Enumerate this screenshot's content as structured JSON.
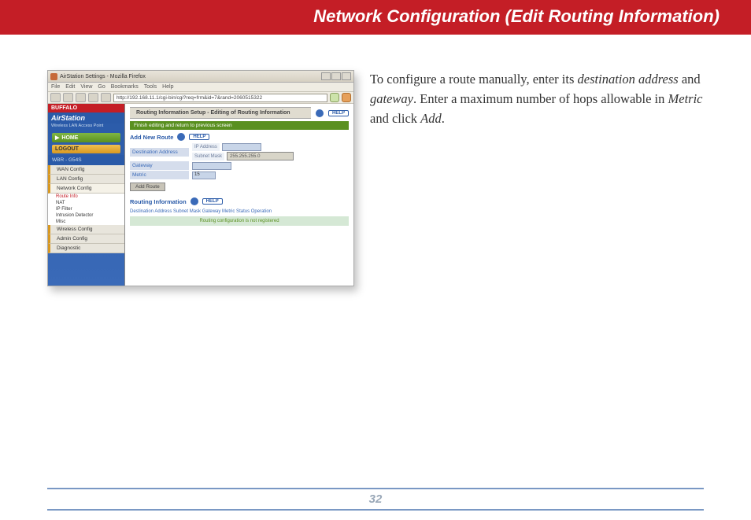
{
  "header": {
    "title": "Network Configuration (Edit Routing Information)"
  },
  "description": {
    "p1_a": "To configure a route manually, enter its ",
    "p1_em1": "destination address",
    "p1_b": " and ",
    "p1_em2": "gateway",
    "p1_c": ".  Enter a maximum number of hops allowable in ",
    "p1_em3": "Metric",
    "p1_d": " and click ",
    "p1_em4": "Add",
    "p1_e": "."
  },
  "footer": {
    "page_number": "32"
  },
  "browser": {
    "window_title": "AirStation Settings - Mozilla Firefox",
    "menu": [
      "File",
      "Edit",
      "View",
      "Go",
      "Bookmarks",
      "Tools",
      "Help"
    ],
    "url": "http://192.168.11.1/cgi-bin/cgi?req=frm&id=7&rand=2060515322",
    "sidebar": {
      "brand": "BUFFALO",
      "product": "AirStation",
      "product_sub": "Wireless LAN Access Point",
      "home": "HOME",
      "logout": "LOGOUT",
      "model": "WBR - G54S",
      "nav": [
        "WAN Config",
        "LAN Config",
        "Network Config"
      ],
      "sub": [
        "Route Info",
        "NAT",
        "IP Filter",
        "Intrusion Detector",
        "Misc"
      ],
      "nav2": [
        "Wireless Config",
        "Admin Config",
        "Diagnostic"
      ]
    },
    "main": {
      "page_title": "Routing Information Setup - Editing of Routing Information",
      "help": "HELP",
      "finish": "Finish editing and return to previous screen",
      "section_addnew": "Add New Route",
      "labels": {
        "dest": "Destination Address",
        "ip": "IP Address",
        "subnet": "Subnet Mask",
        "subnet_val": "255.255.255.0",
        "gateway": "Gateway",
        "metric": "Metric",
        "metric_val": "15",
        "add_route": "Add Route"
      },
      "section_routing": "Routing Information",
      "table_head": "Destination Address Subnet Mask Gateway Metric Status Operation",
      "table_empty": "Routing configuration is not registered"
    }
  }
}
